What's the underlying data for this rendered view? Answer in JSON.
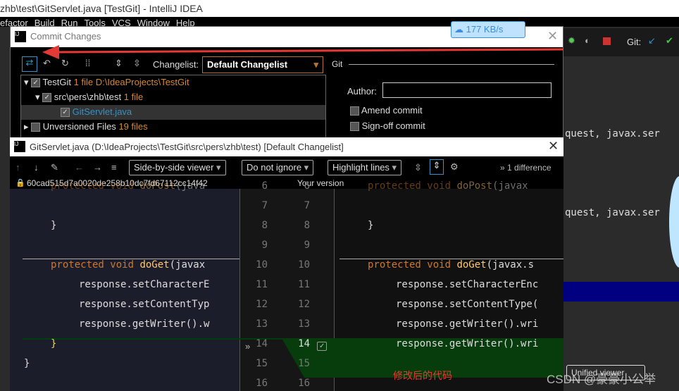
{
  "window_title": "zhb\\test\\GitServlet.java [TestGit] - IntelliJ IDEA",
  "menu": [
    "efactor",
    "Build",
    "Run",
    "Tools",
    "VCS",
    "Window",
    "Help"
  ],
  "net_badge": {
    "speed": "177 KB/s",
    "icon": "cloud-icon"
  },
  "toolbar_right": {
    "git_label": "Git:"
  },
  "background_code": [
    "quest, javax.ser",
    "quest, javax.ser"
  ],
  "commit_dialog": {
    "title": "Commit Changes",
    "changelist_label": "Changelist:",
    "changelist_value": "Default Changelist",
    "git_section": "Git",
    "author_label": "Author:",
    "author_value": "",
    "amend": "Amend commit",
    "signoff": "Sign-off commit",
    "tree": [
      {
        "name": "TestGit",
        "count": "1 file",
        "path": "D:\\IdeaProjects\\TestGit"
      },
      {
        "name": "src\\pers\\zhb\\test",
        "count": "1 file"
      },
      {
        "name": "GitServlet.java"
      },
      {
        "name": "Unversioned Files",
        "count": "19 files"
      }
    ]
  },
  "diff_window": {
    "title": "GitServlet.java (D:\\IdeaProjects\\TestGit\\src\\pers\\zhb\\test) [Default Changelist]",
    "viewer": "Side-by-side viewer",
    "ignore": "Do not ignore",
    "highlight": "Highlight lines",
    "differences": "1 difference",
    "left_revision": "60cad515d7a0020de258b10dc7fd67112cc14f42",
    "right_label": "Your version",
    "left_lines": [
      "protected void doPost(java",
      "",
      "}",
      "",
      "protected void doGet(javax",
      "response.setCharacterE",
      "response.setContentTyp",
      "response.getWriter().w",
      "}",
      "}",
      ""
    ],
    "right_lines": [
      "protected void doPost(javax",
      "",
      "}",
      "",
      "protected void doGet(javax.s",
      "response.setCharacterEnc",
      "response.setContentType(",
      "response.getWriter().wri",
      "response.getWriter().wri",
      "",
      ""
    ],
    "line_numbers": [
      "6",
      "7",
      "8",
      "9",
      "10",
      "11",
      "12",
      "13",
      "14",
      "15",
      "16"
    ],
    "annotation": "修改后的代码"
  },
  "bottom_right": {
    "unified": "Unified viewer",
    "watermark": "CSDN @豪豪小公举"
  },
  "colors": {
    "arrow": "#e53935",
    "added": "#0d3d0d",
    "accent": "#3592c4"
  }
}
